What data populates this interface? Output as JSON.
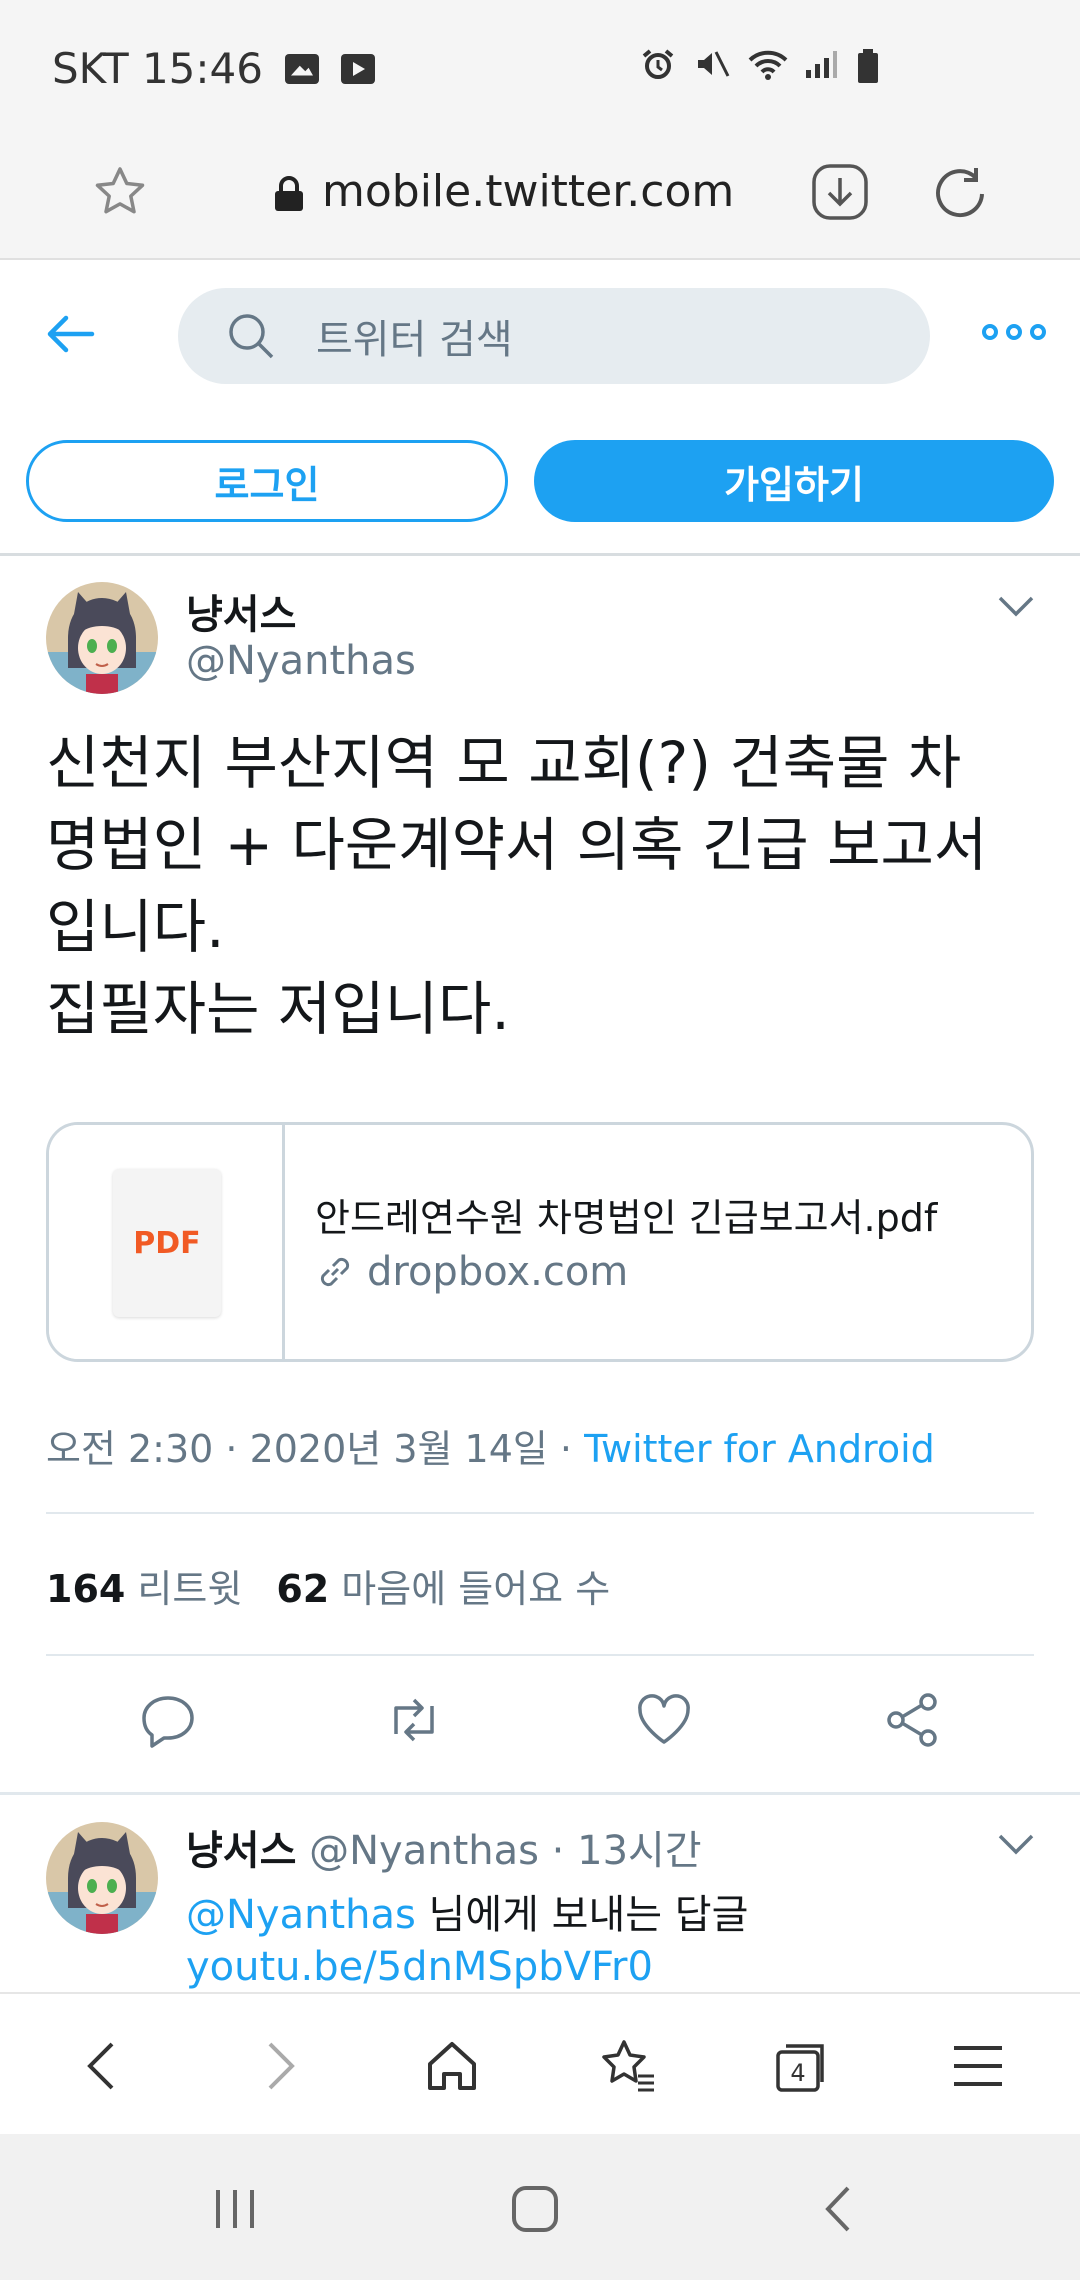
{
  "status_bar": {
    "carrier_time": "SKT 15:46",
    "icons": [
      "gallery-icon",
      "youtube-icon",
      "alarm-icon",
      "mute-icon",
      "wifi-icon",
      "signal-icon",
      "battery-icon"
    ]
  },
  "browser": {
    "url": "mobile.twitter.com",
    "tab_count": "4"
  },
  "header": {
    "search_placeholder": "트위터 검색"
  },
  "auth": {
    "login_label": "로그인",
    "signup_label": "가입하기"
  },
  "tweet": {
    "display_name": "냥서스",
    "handle": "@Nyanthas",
    "text": "신천지 부산지역 모 교회(?) 건축물 차\n명법인 + 다운계약서 의혹 긴급 보고서\n입니다.\n집필자는 저입니다.",
    "card": {
      "thumb_label": "PDF",
      "title": "안드레연수원 차명법인 긴급보고서.pdf",
      "domain": "dropbox.com"
    },
    "timestamp": "오전 2:30 · 2020년 3월 14일 · ",
    "source": "Twitter for Android",
    "retweet_count": "164",
    "retweet_label": "리트윗",
    "like_count": "62",
    "like_label": "마음에 들어요 수"
  },
  "reply": {
    "display_name": "냥서스",
    "handle_time": "@Nyanthas · 13시간",
    "mention": "@Nyanthas",
    "reply_to_text": " 님에게 보내는 답글",
    "link": "youtu.be/5dnMSpbVFr0"
  },
  "colors": {
    "twitter_blue": "#1da1f2",
    "secondary_text": "#657786",
    "primary_text": "#14171a"
  }
}
